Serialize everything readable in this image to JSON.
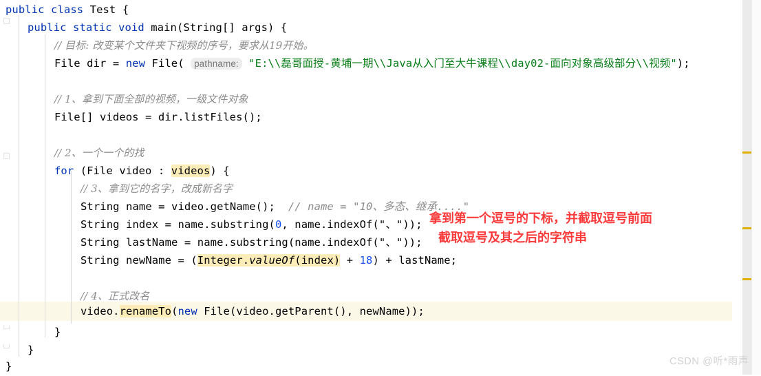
{
  "editor": {
    "app": "IntelliJ IDEA Java editor",
    "language": "Java",
    "theme_background": "#ffffff",
    "current_line_highlight_color": "#fcf8e8",
    "identifier_highlight_color": "#fcecb8",
    "keyword_color": "#0033b3",
    "string_color": "#067d17",
    "number_color": "#1750eb",
    "comment_color": "#8c8c8c",
    "annotation_color": "#fb3b3b",
    "stripe_mark_color": "#e0b000"
  },
  "code": {
    "line01": {
      "kw1": "public",
      "kw2": "class",
      "name": "Test",
      "brace": "{"
    },
    "line02": {
      "kw1": "public",
      "kw2": "static",
      "kw3": "void",
      "name": "main",
      "sig": "(String[] args) {"
    },
    "line03": {
      "text": "// 目标: 改变某个文件夹下视频的序号，要求从19开始。"
    },
    "line04": {
      "pre": "File dir = ",
      "kw": "new",
      "mid": " File( ",
      "hint": "pathname:",
      "str": "\"E:\\\\磊哥面授-黄埔一期\\\\Java从入门至大牛课程\\\\day02-面向对象高级部分\\\\视频\"",
      "post": ");"
    },
    "line05": {
      "text": "// 1、拿到下面全部的视频，一级文件对象"
    },
    "line06": {
      "text": "File[] videos = dir.listFiles();"
    },
    "line07": {
      "text": "// 2、一个一个的找"
    },
    "line08": {
      "kw": "for",
      "pre": " (File video : ",
      "hl": "videos",
      "post": ") {"
    },
    "line09": {
      "text": "// 3、拿到它的名字，改成新名字"
    },
    "line10": {
      "code": "String name = video.getName();",
      "comment": "// name = \"10、多态、继承....\""
    },
    "line11": {
      "code": "String index = name.substring(",
      "num": "0",
      "post": ", name.indexOf(\"、\"));"
    },
    "line12": {
      "code": "String lastName = name.substring(name.indexOf(\"、\"));"
    },
    "line13": {
      "pre": "String newName = (",
      "hl_a": "Integer.",
      "hl_b": "valueOf",
      "hl_c": "(index)",
      "mid": " + ",
      "num": "18",
      "post": ") + lastName;"
    },
    "line14": {
      "text": "// 4、正式改名"
    },
    "line15": {
      "pre": "video.",
      "hl": "renameTo",
      "paren": "(",
      "kw": "new",
      "post": " File(video.getParent(), newName));"
    },
    "line16": {
      "text": "}"
    },
    "line17": {
      "text": "}"
    },
    "line18": {
      "text": "}"
    }
  },
  "annotations": {
    "line1": "拿到第一个逗号的下标，并截取逗号前面",
    "line2": "截取逗号及其之后的字符串"
  },
  "watermark": {
    "text": "CSDN @听*雨声"
  }
}
